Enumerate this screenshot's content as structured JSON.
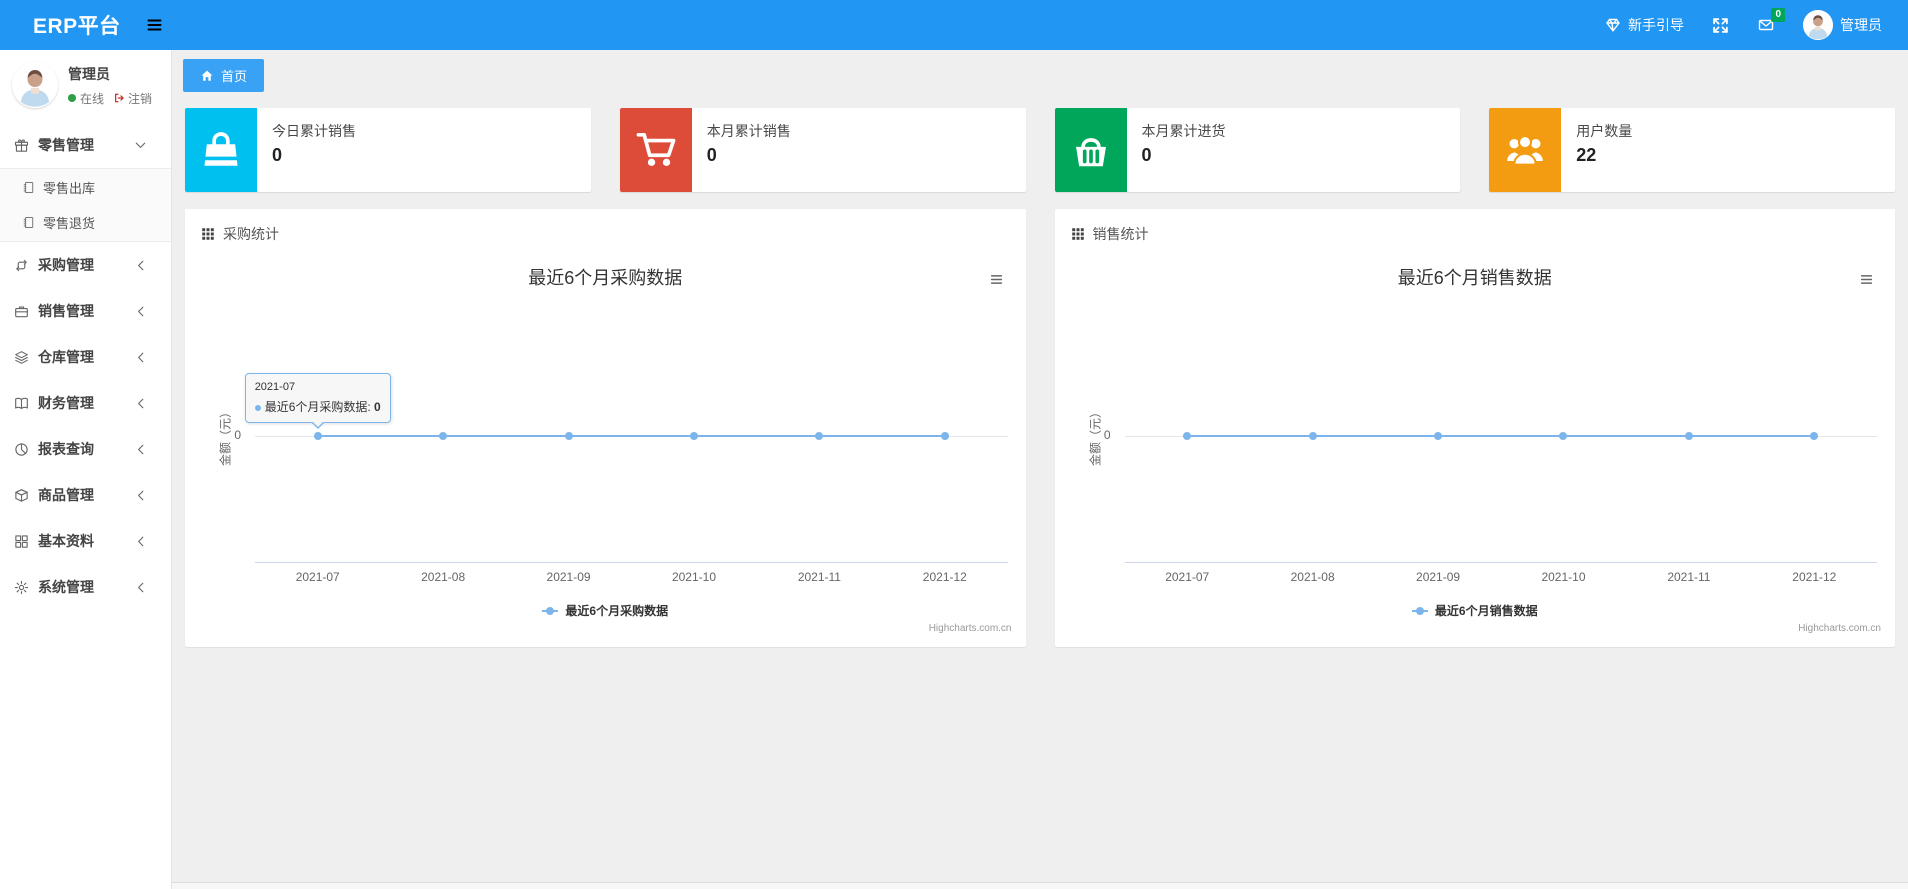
{
  "navbar": {
    "brand": "ERP平台",
    "guide_label": "新手引导",
    "message_badge": "0",
    "username": "管理员",
    "icons": [
      "hamburger-icon",
      "gem-icon",
      "fullscreen-icon",
      "envelope-icon",
      "avatar"
    ]
  },
  "sidebar": {
    "user": {
      "name": "管理员",
      "status": "在线",
      "logout": "注销"
    },
    "items": [
      {
        "id": "retail",
        "label": "零售管理",
        "icon": "gift-icon",
        "state": "expanded",
        "children": [
          {
            "id": "retail-outbound",
            "label": "零售出库",
            "icon": "journal-icon"
          },
          {
            "id": "retail-return",
            "label": "零售退货",
            "icon": "journal-icon"
          }
        ]
      },
      {
        "id": "purchase",
        "label": "采购管理",
        "icon": "repeat-icon",
        "state": "collapsed"
      },
      {
        "id": "sales",
        "label": "销售管理",
        "icon": "briefcase-icon",
        "state": "collapsed"
      },
      {
        "id": "warehouse",
        "label": "仓库管理",
        "icon": "layers-icon",
        "state": "collapsed"
      },
      {
        "id": "finance",
        "label": "财务管理",
        "icon": "book-icon",
        "state": "collapsed"
      },
      {
        "id": "reports",
        "label": "报表查询",
        "icon": "pie-chart-icon",
        "state": "collapsed"
      },
      {
        "id": "goods",
        "label": "商品管理",
        "icon": "box-icon",
        "state": "collapsed"
      },
      {
        "id": "basic-data",
        "label": "基本资料",
        "icon": "grid-icon",
        "state": "collapsed"
      },
      {
        "id": "system",
        "label": "系统管理",
        "icon": "gear-icon",
        "state": "collapsed"
      }
    ]
  },
  "tabs": [
    {
      "id": "home",
      "label": "首页",
      "icon": "home-icon",
      "active": true
    }
  ],
  "cards": [
    {
      "id": "today-sales",
      "label": "今日累计销售",
      "value": "0",
      "color": "#00c0ef",
      "icon": "shopping-bag-icon"
    },
    {
      "id": "month-sales",
      "label": "本月累计销售",
      "value": "0",
      "color": "#dd4b39",
      "icon": "cart-icon"
    },
    {
      "id": "month-purchase",
      "label": "本月累计进货",
      "value": "0",
      "color": "#00a65a",
      "icon": "basket-icon"
    },
    {
      "id": "user-count",
      "label": "用户数量",
      "value": "22",
      "color": "#f39c12",
      "icon": "users-icon"
    }
  ],
  "chart_data": [
    {
      "id": "purchase-stats",
      "type": "line",
      "panel_title": "采购统计",
      "title": "最近6个月采购数据",
      "categories": [
        "2021-07",
        "2021-08",
        "2021-09",
        "2021-10",
        "2021-11",
        "2021-12"
      ],
      "series": [
        {
          "name": "最近6个月采购数据",
          "values": [
            0,
            0,
            0,
            0,
            0,
            0
          ],
          "color": "#7cb5ec"
        }
      ],
      "ylabel": "金额（元）",
      "yticks": [
        "0"
      ],
      "ylim": [
        -1,
        1
      ],
      "grid": "zero-line-only",
      "legend_position": "bottom",
      "credits": "Highcharts.com.cn",
      "tooltip": {
        "visible": true,
        "category": "2021-07",
        "series_name": "最近6个月采购数据",
        "value": "0",
        "point_index": 0
      }
    },
    {
      "id": "sales-stats",
      "type": "line",
      "panel_title": "销售统计",
      "title": "最近6个月销售数据",
      "categories": [
        "2021-07",
        "2021-08",
        "2021-09",
        "2021-10",
        "2021-11",
        "2021-12"
      ],
      "series": [
        {
          "name": "最近6个月销售数据",
          "values": [
            0,
            0,
            0,
            0,
            0,
            0
          ],
          "color": "#7cb5ec"
        }
      ],
      "ylabel": "金额（元）",
      "yticks": [
        "0"
      ],
      "ylim": [
        -1,
        1
      ],
      "grid": "zero-line-only",
      "legend_position": "bottom",
      "credits": "Highcharts.com.cn",
      "tooltip": {
        "visible": false
      }
    }
  ],
  "colors": {
    "navbar_blue": "#2196f3",
    "tab_active_blue": "#39a2f4",
    "series_line": "#7cb5ec",
    "card_aqua": "#00c0ef",
    "card_red": "#dd4b39",
    "card_green": "#00a65a",
    "card_orange": "#f39c12",
    "badge_green": "#00a65a",
    "online_dot_green": "#2e9e44",
    "logout_red": "#c9302c"
  }
}
